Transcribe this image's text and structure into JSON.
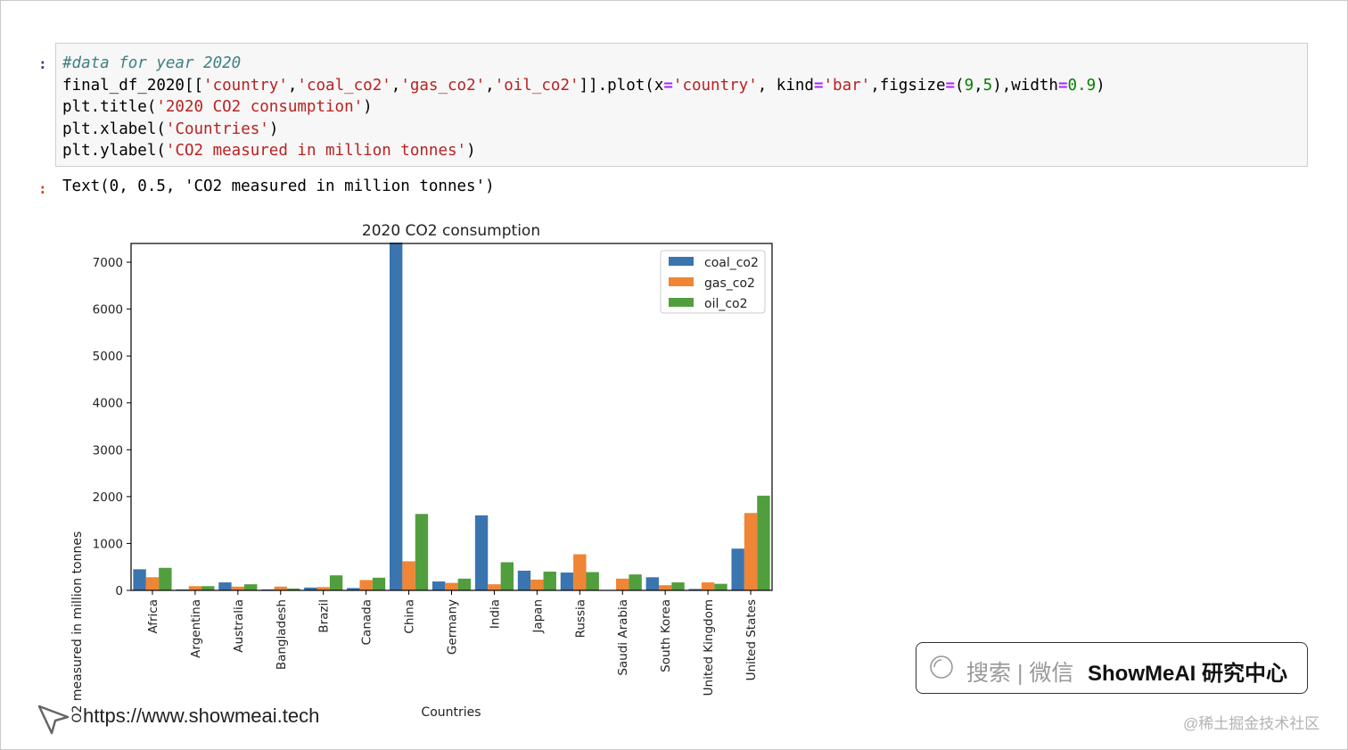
{
  "notebook": {
    "in_prompt": ":",
    "out_prompt": ":",
    "code_lines": [
      "#data for year 2020",
      "final_df_2020[['country','coal_co2','gas_co2','oil_co2']].plot(x='country', kind='bar',figsize=(9,5),width=0.9)",
      "plt.title('2020 CO2 consumption')",
      "plt.xlabel('Countries')",
      "plt.ylabel('CO2 measured in million tonnes')"
    ],
    "output_text": "Text(0, 0.5, 'CO2 measured in million tonnes')"
  },
  "chart_data": {
    "type": "bar",
    "title": "2020 CO2 consumption",
    "xlabel": "Countries",
    "ylabel": "CO2 measured in million tonnes",
    "ylim": [
      0,
      7400
    ],
    "yticks": [
      0,
      1000,
      2000,
      3000,
      4000,
      5000,
      6000,
      7000
    ],
    "legend_position": "top-right",
    "categories": [
      "Africa",
      "Argentina",
      "Australia",
      "Bangladesh",
      "Brazil",
      "Canada",
      "China",
      "Germany",
      "India",
      "Japan",
      "Russia",
      "Saudi Arabia",
      "South Korea",
      "United Kingdom",
      "United States"
    ],
    "series": [
      {
        "name": "coal_co2",
        "color": "#3a75b0",
        "values": [
          450,
          20,
          170,
          20,
          60,
          50,
          7420,
          190,
          1600,
          420,
          380,
          0,
          280,
          30,
          890
        ]
      },
      {
        "name": "gas_co2",
        "color": "#ef8535",
        "values": [
          280,
          90,
          80,
          80,
          70,
          220,
          620,
          160,
          130,
          230,
          770,
          250,
          110,
          170,
          1650
        ]
      },
      {
        "name": "oil_co2",
        "color": "#519e3e",
        "values": [
          480,
          90,
          130,
          40,
          320,
          270,
          1630,
          250,
          600,
          400,
          390,
          340,
          170,
          140,
          2020
        ]
      }
    ]
  },
  "brand": {
    "search_text": "搜索 | 微信",
    "name": "ShowMeAI 研究中心",
    "url": "https://www.showmeai.tech",
    "watermark": "@稀土掘金技术社区"
  }
}
